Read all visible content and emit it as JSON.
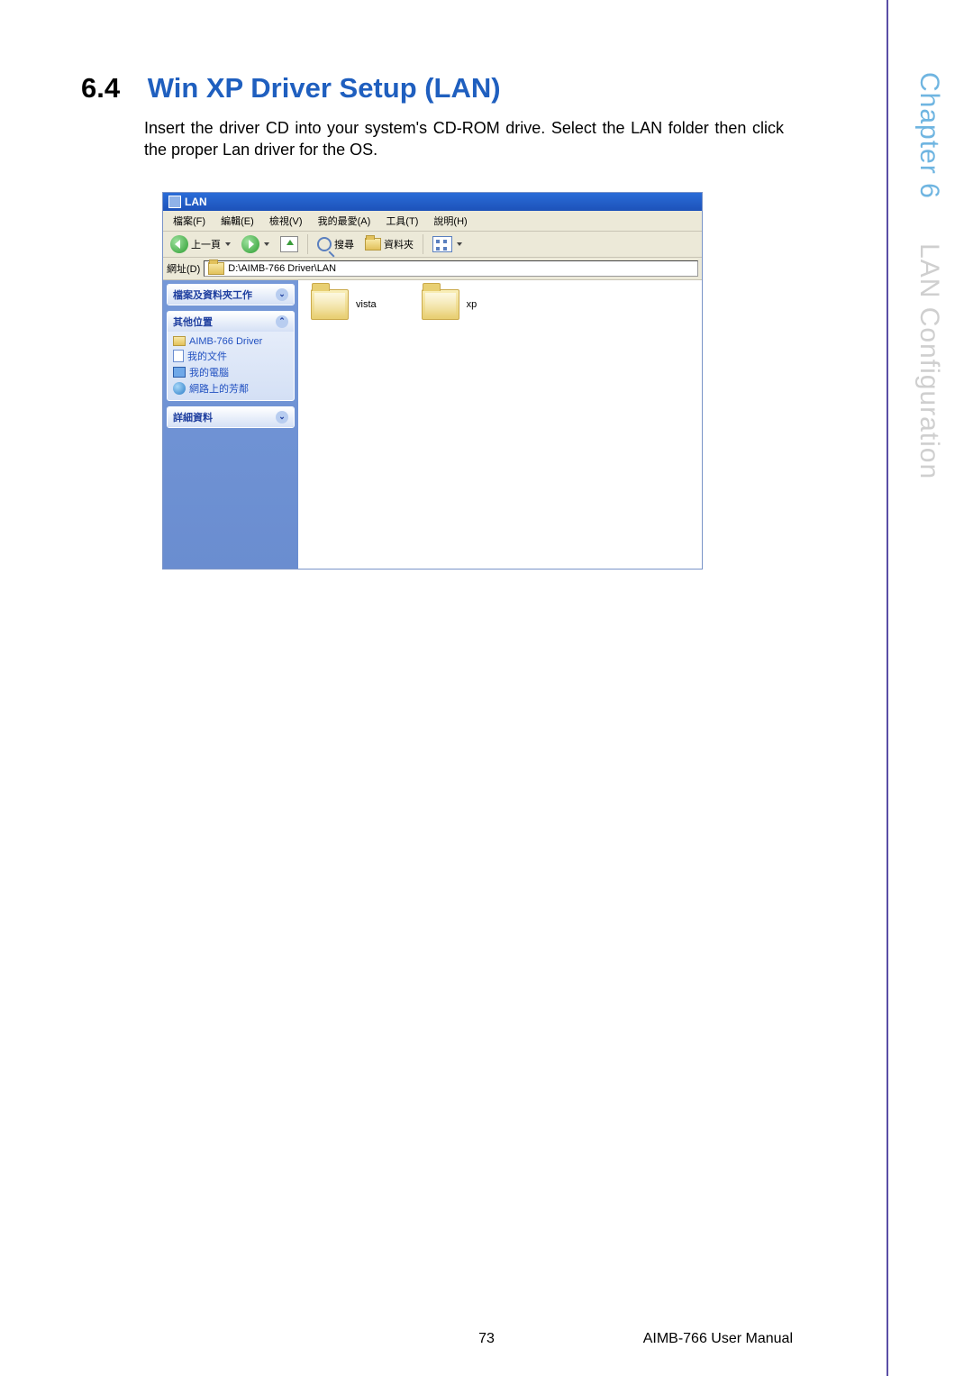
{
  "section": {
    "number": "6.4",
    "title": "Win XP Driver Setup (LAN)"
  },
  "body": "Insert the driver CD into your system's CD-ROM drive. Select the LAN folder then click the proper Lan driver for the OS.",
  "rail": {
    "chapter": "Chapter 6",
    "subtitle": "LAN Configuration"
  },
  "window": {
    "title": "LAN",
    "menu": {
      "file": "檔案(F)",
      "edit": "編輯(E)",
      "view": "檢視(V)",
      "favorites": "我的最愛(A)",
      "tools": "工具(T)",
      "help": "說明(H)"
    },
    "toolbar": {
      "back": "上一頁",
      "search": "搜尋",
      "folders": "資料夾"
    },
    "address": {
      "label": "網址(D)",
      "path": "D:\\AIMB-766 Driver\\LAN"
    },
    "side": {
      "tasks_header": "檔案及資料夾工作",
      "other_header": "其他位置",
      "other_items": {
        "driver": "AIMB-766 Driver",
        "docs": "我的文件",
        "pc": "我的電腦",
        "net": "網路上的芳鄰"
      },
      "details_header": "詳細資料"
    },
    "folders": {
      "vista": "vista",
      "xp": "xp"
    }
  },
  "footer": {
    "page": "73",
    "manual": "AIMB-766 User Manual"
  }
}
